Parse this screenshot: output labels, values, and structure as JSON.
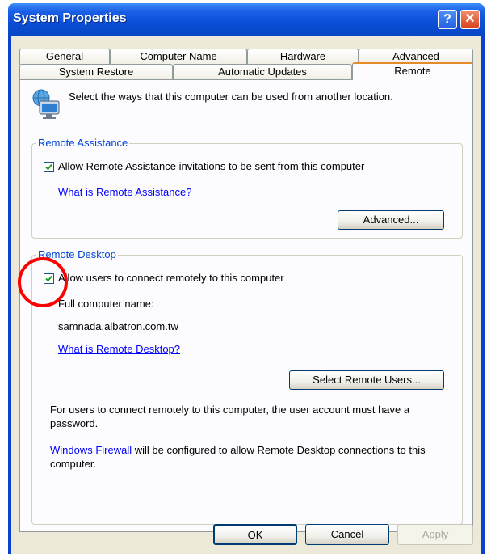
{
  "window": {
    "title": "System Properties",
    "help_glyph": "?",
    "close_glyph": "✕"
  },
  "tabs": {
    "row1": [
      "General",
      "Computer Name",
      "Hardware",
      "Advanced"
    ],
    "row2": [
      "System Restore",
      "Automatic Updates",
      "Remote"
    ],
    "active": "Remote"
  },
  "intro": {
    "text": "Select the ways that this computer can be used from another location.",
    "icon": "computer-network-icon"
  },
  "remote_assistance": {
    "legend": "Remote Assistance",
    "checkbox_label": "Allow Remote Assistance invitations to be sent from this computer",
    "checked": true,
    "help_link": "What is Remote Assistance?",
    "advanced_button": "Advanced..."
  },
  "remote_desktop": {
    "legend": "Remote Desktop",
    "checkbox_label": "Allow users to connect remotely to this computer",
    "checked": true,
    "computer_name_label": "Full computer name:",
    "computer_name": "samnada.albatron.com.tw",
    "help_link": "What is Remote Desktop?",
    "select_users_button": "Select Remote Users...",
    "password_note": "For users to connect remotely to this computer, the user account must have a password.",
    "firewall_link": "Windows Firewall",
    "firewall_note": " will be configured to allow Remote Desktop connections to this computer."
  },
  "footer": {
    "ok": "OK",
    "cancel": "Cancel",
    "apply": "Apply"
  },
  "annotation_color": "#ff0000"
}
